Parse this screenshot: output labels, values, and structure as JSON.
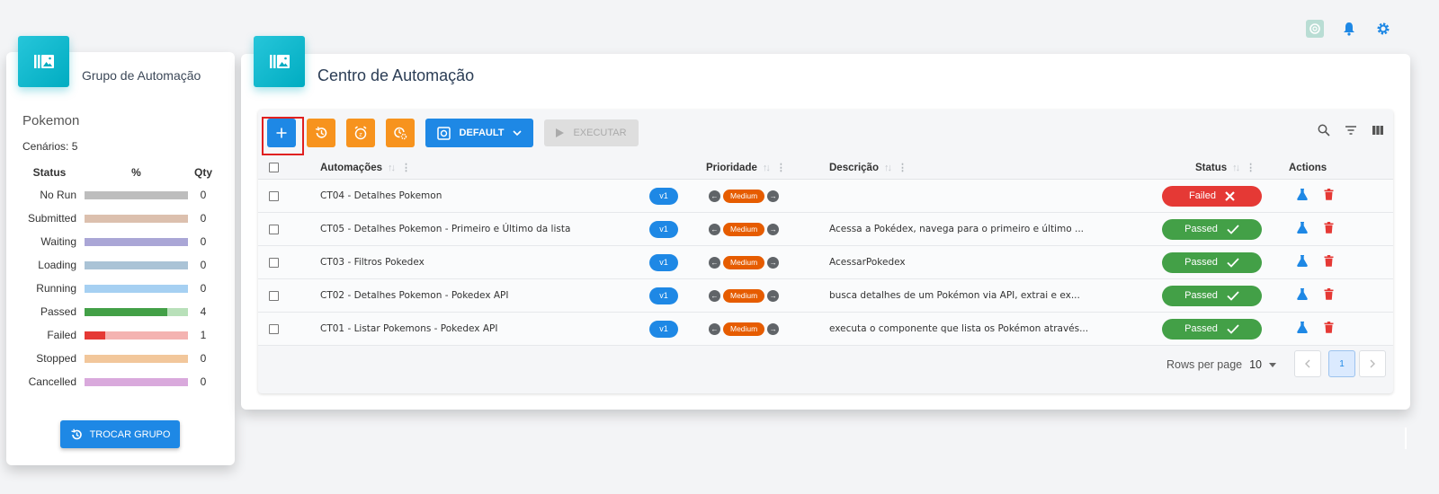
{
  "topbar": {
    "icons": [
      "openai-icon",
      "bell-icon",
      "gear-icon"
    ]
  },
  "group_card": {
    "title": "Grupo de Automação",
    "group_name": "Pokemon",
    "scenarios_label": "Cenários: 5",
    "status_header": {
      "status": "Status",
      "pct": "%",
      "qty": "Qty"
    },
    "statuses": [
      {
        "label": "No Run",
        "qty": "0",
        "fraction": 0,
        "color": "#bdbdbd",
        "light": "#bdbdbd"
      },
      {
        "label": "Submitted",
        "qty": "0",
        "fraction": 0,
        "color": "#d9b8a0",
        "light": "#dcc0ae"
      },
      {
        "label": "Waiting",
        "qty": "0",
        "fraction": 0,
        "color": "#a9a6d6",
        "light": "#aaa6d6"
      },
      {
        "label": "Loading",
        "qty": "0",
        "fraction": 0,
        "color": "#a9c3d6",
        "light": "#aac3d6"
      },
      {
        "label": "Running",
        "qty": "0",
        "fraction": 0,
        "color": "#a6d0f2",
        "light": "#a6d0f2"
      },
      {
        "label": "Passed",
        "qty": "4",
        "fraction": 0.8,
        "color": "#43a047",
        "light": "#b8e0b9"
      },
      {
        "label": "Failed",
        "qty": "1",
        "fraction": 0.2,
        "color": "#e53935",
        "light": "#f4b3b1"
      },
      {
        "label": "Stopped",
        "qty": "0",
        "fraction": 0,
        "color": "#f2c79b",
        "light": "#f2c79b"
      },
      {
        "label": "Cancelled",
        "qty": "0",
        "fraction": 0,
        "color": "#d9a9dc",
        "light": "#d9a9dc"
      }
    ],
    "button": "TROCAR GRUPO"
  },
  "main_card": {
    "title": "Centro de Automação",
    "toolbar": {
      "default_label": "DEFAULT",
      "execute_label": "EXECUTAR"
    },
    "columns": {
      "automacoes": "Automações",
      "prioridade": "Prioridade",
      "descricao": "Descrição",
      "status": "Status",
      "actions": "Actions"
    },
    "rows": [
      {
        "name": "CT04 - Detalhes Pokemon",
        "version": "v1",
        "priority": "Medium",
        "description": "",
        "status": "Failed"
      },
      {
        "name": "CT05 - Detalhes Pokemon - Primeiro e Último da lista",
        "version": "v1",
        "priority": "Medium",
        "description": "Acessa a Pokédex, navega para o primeiro e último ...",
        "status": "Passed"
      },
      {
        "name": "CT03 - Filtros Pokedex",
        "version": "v1",
        "priority": "Medium",
        "description": "AcessarPokedex",
        "status": "Passed"
      },
      {
        "name": "CT02 - Detalhes Pokemon - Pokedex API",
        "version": "v1",
        "priority": "Medium",
        "description": "busca detalhes de um Pokémon via API, extrai e ex...",
        "status": "Passed"
      },
      {
        "name": "CT01 - Listar Pokemons - Pokedex API",
        "version": "v1",
        "priority": "Medium",
        "description": "executa o componente que lista os Pokémon através...",
        "status": "Passed"
      }
    ],
    "pagination": {
      "rows_per_page_label": "Rows per page",
      "rows_per_page": "10",
      "current_page": "1"
    }
  }
}
